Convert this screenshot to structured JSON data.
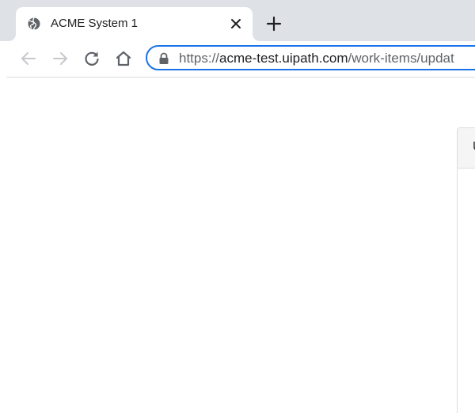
{
  "tab": {
    "favicon": "globe-icon",
    "title": "ACME System 1",
    "close": "close-icon"
  },
  "newtab": "plus-icon",
  "toolbar": {
    "back": "arrow-left-icon",
    "forward": "arrow-right-icon",
    "reload": "reload-icon",
    "home": "home-icon",
    "lock": "lock-icon",
    "url_scheme": "https://",
    "url_host": "acme-test.uipath.com",
    "url_path": "/work-items/updat"
  },
  "panel": {
    "header_text": "U"
  },
  "colors": {
    "tabstrip": "#dee1e6",
    "accent": "#1a73e8",
    "icon": "#5f6368"
  }
}
